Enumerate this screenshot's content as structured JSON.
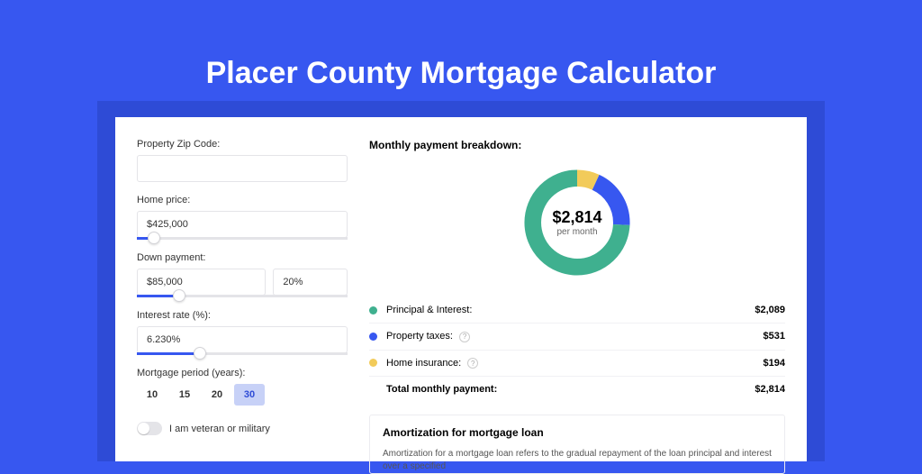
{
  "page": {
    "title": "Placer County Mortgage Calculator"
  },
  "form": {
    "zip_label": "Property Zip Code:",
    "zip_value": "",
    "home_price_label": "Home price:",
    "home_price_value": "$425,000",
    "home_price_slider_pct": 8,
    "down_payment_label": "Down payment:",
    "down_payment_value": "$85,000",
    "down_payment_pct_value": "20%",
    "down_payment_slider_pct": 20,
    "interest_label": "Interest rate (%):",
    "interest_value": "6.230%",
    "interest_slider_pct": 30,
    "period_label": "Mortgage period (years):",
    "periods": [
      "10",
      "15",
      "20",
      "30"
    ],
    "period_selected": "30",
    "veteran_label": "I am veteran or military"
  },
  "breakdown": {
    "title": "Monthly payment breakdown:",
    "center_amount": "$2,814",
    "center_sub": "per month",
    "rows": [
      {
        "label": "Principal & Interest:",
        "value": "$2,089",
        "color": "#3fb08f",
        "info": false
      },
      {
        "label": "Property taxes:",
        "value": "$531",
        "color": "#3757f0",
        "info": true
      },
      {
        "label": "Home insurance:",
        "value": "$194",
        "color": "#f2cb5a",
        "info": true
      }
    ],
    "total": {
      "label": "Total monthly payment:",
      "value": "$2,814"
    }
  },
  "amortization": {
    "title": "Amortization for mortgage loan",
    "text": "Amortization for a mortgage loan refers to the gradual repayment of the loan principal and interest over a specified"
  },
  "chart_data": {
    "type": "pie",
    "title": "Monthly payment breakdown",
    "categories": [
      "Principal & Interest",
      "Property taxes",
      "Home insurance"
    ],
    "values": [
      2089,
      531,
      194
    ],
    "colors": [
      "#3fb08f",
      "#3757f0",
      "#f2cb5a"
    ],
    "total": 2814,
    "center_label": "$2,814 per month"
  }
}
